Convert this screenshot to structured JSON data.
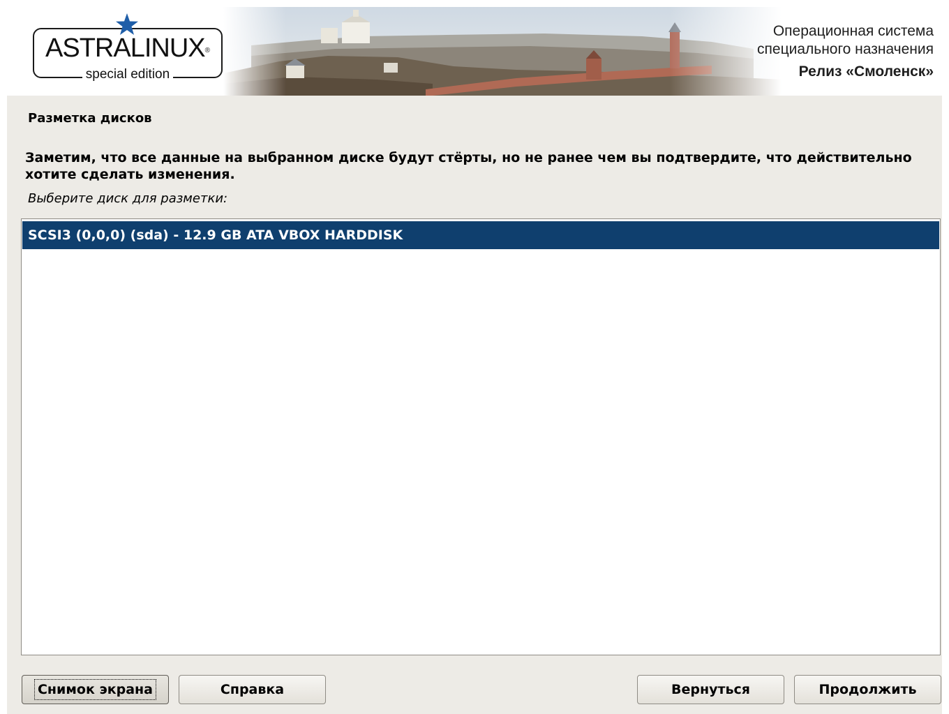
{
  "banner": {
    "logo_main": "ASTRALINUX",
    "logo_registered": "®",
    "logo_sub": "special edition",
    "logo_icon": "star-icon",
    "accent_color": "#1f5ea8",
    "line1": "Операционная система",
    "line2": "специального назначения",
    "line3": "Релиз «Смоленск»"
  },
  "page": {
    "title": "Разметка дисков",
    "note": "Заметим, что все данные на выбранном диске будут стёрты, но не ранее чем вы подтвердите, что действительно хотите сделать изменения.",
    "prompt": "Выберите диск для разметки:"
  },
  "disks": {
    "items": [
      {
        "label": "SCSI3 (0,0,0) (sda) - 12.9 GB ATA VBOX HARDDISK",
        "selected": true
      }
    ],
    "selection_color": "#0f3f6e"
  },
  "buttons": {
    "screenshot": "Снимок экрана",
    "help": "Справка",
    "back": "Вернуться",
    "continue": "Продолжить"
  }
}
